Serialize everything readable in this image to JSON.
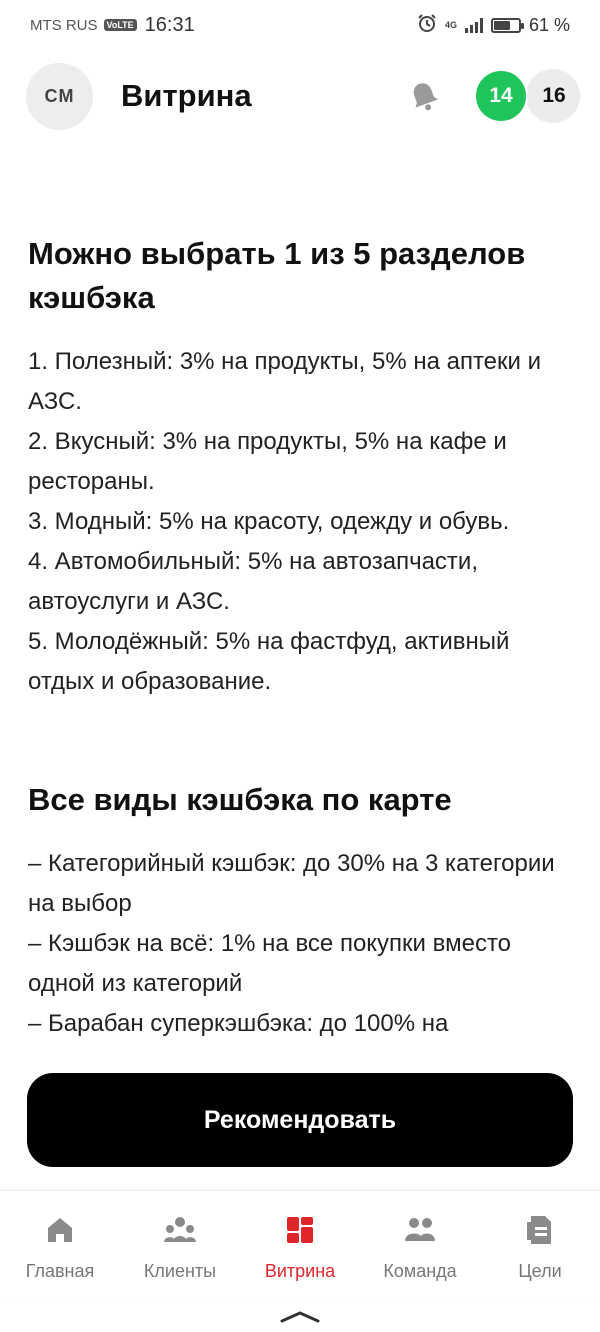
{
  "status_bar": {
    "carrier": "MTS RUS",
    "volte": "VoLTE",
    "time": "16:31",
    "network": "4G",
    "battery_percent": "61 %",
    "battery_level": 0.61,
    "icons": [
      "alarm-icon",
      "signal-icon",
      "battery-icon"
    ]
  },
  "header": {
    "avatar_initials": "CM",
    "title": "Витрина",
    "counter_green": "14",
    "counter_gray": "16",
    "accent_green": "#1fc45a"
  },
  "section1": {
    "title": "Можно выбрать 1 из 5 разделов кэшбэка",
    "items": [
      "1. Полезный: 3% на продукты, 5% на аптеки и АЗС.",
      "2. Вкусный: 3% на продукты, 5% на кафе и рестораны.",
      "3. Модный: 5% на красоту, одежду и обувь.",
      "4. Автомобильный: 5% на автозапчасти, автоуслуги и АЗС.",
      "5. Молодёжный: 5% на фастфуд, активный отдых и образование."
    ]
  },
  "section2": {
    "title": "Все виды кэшбэка по карте",
    "items": [
      "– Категорийный кэшбэк: до 30% на 3 категории на выбор",
      "– Кэшбэк на всё: 1% на все покупки вместо одной из категорий",
      "– Барабан суперкэшбэка: до 100% на"
    ]
  },
  "cta": {
    "label": "Рекомендовать"
  },
  "nav": {
    "active_color": "#e0262a",
    "items": [
      {
        "label": "Главная",
        "icon": "home-icon"
      },
      {
        "label": "Клиенты",
        "icon": "clients-icon"
      },
      {
        "label": "Витрина",
        "icon": "showcase-icon",
        "active": true
      },
      {
        "label": "Команда",
        "icon": "team-icon"
      },
      {
        "label": "Цели",
        "icon": "goals-icon"
      }
    ]
  }
}
